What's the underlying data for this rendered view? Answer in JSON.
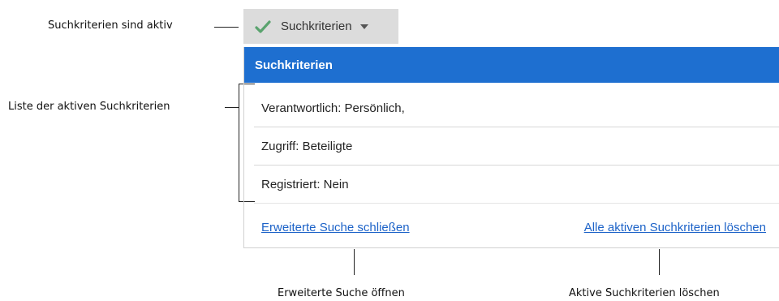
{
  "callouts": {
    "filters_active": "Suchkriterien sind aktiv",
    "active_list": "Liste der aktiven Suchkriterien",
    "open_search": "Erweiterte Suche öffnen",
    "clear_filters": "Aktive Suchkriterien löschen"
  },
  "toggle": {
    "label": "Suchkriterien",
    "icon": "check-icon",
    "accent": "#5aa36e"
  },
  "panel": {
    "header": "Suchkriterien",
    "header_color": "#1e6fd0",
    "criteria": [
      "Verantwortlich: Persönlich,",
      "Zugriff: Beteiligte",
      "Registriert: Nein"
    ],
    "close_link": "Erweiterte Suche schließen",
    "clear_link": "Alle aktiven Suchkriterien löschen"
  }
}
